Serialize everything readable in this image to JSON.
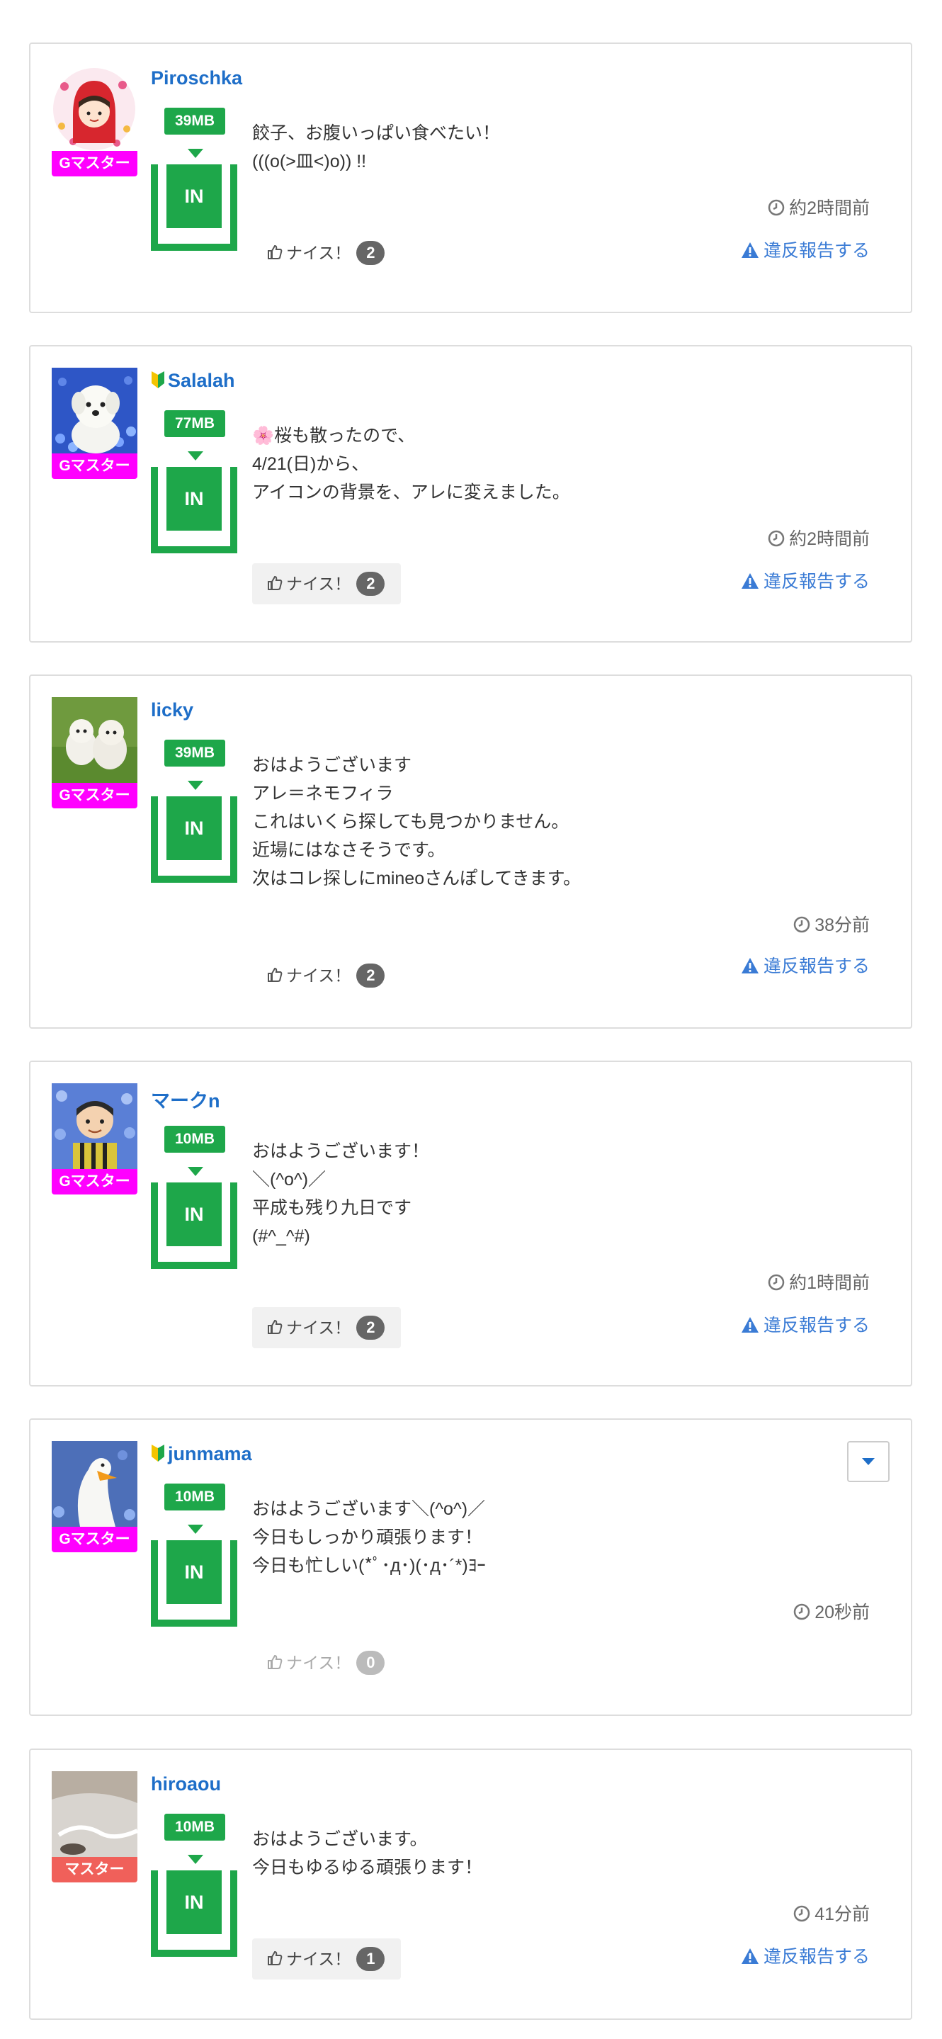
{
  "colors": {
    "g_master_badge": "#ff00ff",
    "master_badge": "#f0605a",
    "data_green": "#1ea74a",
    "username_blue": "#1e6ec8",
    "report_blue": "#3a7bd5"
  },
  "labels": {
    "in": "IN",
    "nice": "ナイス！",
    "report": "違反報告する"
  },
  "posts": [
    {
      "username": "Piroschka",
      "beginner": false,
      "badge": "Gマスター",
      "badge_color": "#ff00ff",
      "data_size": "39MB",
      "message": "餃子、お腹いっぱい食べたい！\n(((o(>皿<)o)) !!",
      "time": "約2時間前",
      "nice_count": "2",
      "nice_bg": false,
      "show_report": true,
      "show_dropdown": false,
      "avatar_icon": "red-riding-hood-avatar"
    },
    {
      "username": "Salalah",
      "beginner": true,
      "badge": "Gマスター",
      "badge_color": "#ff00ff",
      "data_size": "77MB",
      "message": "🌸桜も散ったので、\n4/21(日)から、\nアイコンの背景を、アレに変えました。",
      "time": "約2時間前",
      "nice_count": "2",
      "nice_bg": true,
      "show_report": true,
      "show_dropdown": false,
      "avatar_icon": "white-dog-flowers-avatar"
    },
    {
      "username": "licky",
      "beginner": false,
      "badge": "Gマスター",
      "badge_color": "#ff00ff",
      "data_size": "39MB",
      "message": "おはようございます\nアレ＝ネモフィラ\nこれはいくら探しても見つかりません。\n近場にはなさそうです。\n次はコレ探しにmineoさんぽしてきます。",
      "time": "38分前",
      "nice_count": "2",
      "nice_bg": false,
      "show_report": true,
      "show_dropdown": false,
      "avatar_icon": "two-dogs-grass-avatar"
    },
    {
      "username": "マークn",
      "beginner": false,
      "badge": "Gマスター",
      "badge_color": "#ff00ff",
      "data_size": "10MB",
      "message": "おはようございます！\n＼(^o^)／\n平成も残り九日です\n(#^_^#)",
      "time": "約1時間前",
      "nice_count": "2",
      "nice_bg": true,
      "show_report": true,
      "show_dropdown": false,
      "avatar_icon": "man-flowers-avatar"
    },
    {
      "username": "junmama",
      "beginner": true,
      "badge": "Gマスター",
      "badge_color": "#ff00ff",
      "data_size": "10MB",
      "message": "おはようございます＼(^o^)／\n今日もしっかり頑張ります！\n今日も忙しい(*ﾟ･д･)(･д･´*)ﾖｰ",
      "time": "20秒前",
      "nice_count": "0",
      "nice_bg": false,
      "nice_faded": true,
      "show_report": false,
      "show_dropdown": true,
      "avatar_icon": "swan-flowers-avatar"
    },
    {
      "username": "hiroaou",
      "beginner": false,
      "badge": "マスター",
      "badge_color": "#f0605a",
      "data_size": "10MB",
      "message": "おはようございます。\n今日もゆるゆる頑張ります！",
      "time": "41分前",
      "nice_count": "1",
      "nice_bg": true,
      "show_report": true,
      "show_dropdown": false,
      "avatar_icon": "car-photo-avatar"
    }
  ]
}
